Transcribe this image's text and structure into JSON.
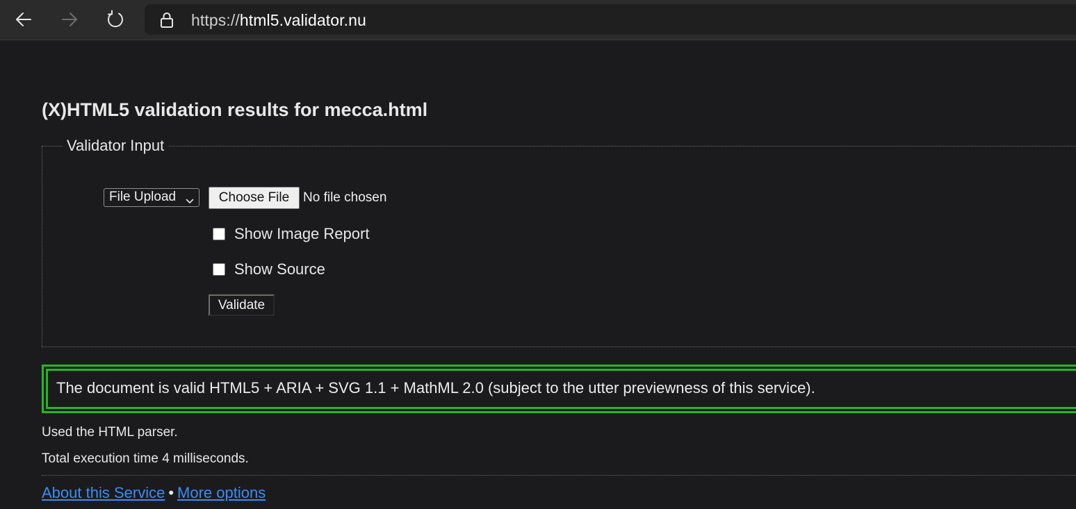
{
  "browser": {
    "url_scheme": "https://",
    "url_host": "html5.validator.nu",
    "icons": {
      "back": "arrow-left-icon",
      "forward": "arrow-right-icon",
      "reload": "reload-icon",
      "security": "lock-icon"
    }
  },
  "page": {
    "title": "(X)HTML5 validation results for mecca.html"
  },
  "validator_input": {
    "legend": "Validator Input",
    "input_mode": "File Upload",
    "choose_file_label": "Choose File",
    "file_status": "No file chosen",
    "options": [
      {
        "label": "Show Image Report",
        "checked": false
      },
      {
        "label": "Show Source",
        "checked": false
      }
    ],
    "validate_label": "Validate"
  },
  "result": {
    "message": "The document is valid HTML5 + ARIA + SVG 1.1 + MathML 2.0 (subject to the utter previewness of this service).",
    "status_color": "#22b922"
  },
  "info": {
    "parser": "Used the HTML parser.",
    "execution_time": "Total execution time 4 milliseconds."
  },
  "footer": {
    "about_link": "About this Service",
    "separator": "•",
    "more_options_link": "More options",
    "link_color": "#3b8cf6"
  }
}
